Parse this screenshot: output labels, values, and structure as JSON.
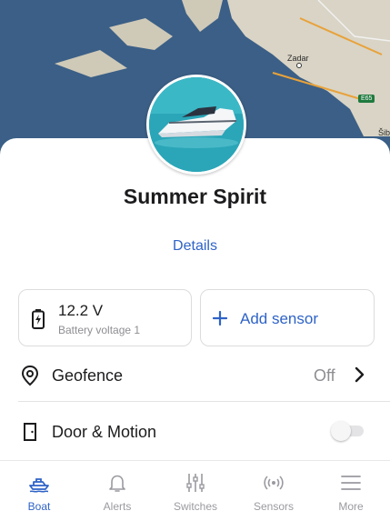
{
  "map": {
    "city_label": "Zadar",
    "road_shield": "E65",
    "edge_label": "Šib"
  },
  "boat": {
    "name": "Summer Spirit",
    "details_label": "Details"
  },
  "cards": {
    "battery": {
      "value": "12.2 V",
      "label": "Battery voltage 1",
      "icon": "battery-charging-icon"
    },
    "add_sensor": {
      "label": "Add sensor",
      "icon": "plus-icon"
    }
  },
  "rows": {
    "geofence": {
      "label": "Geofence",
      "value": "Off",
      "icon": "location-pin-icon"
    },
    "door_motion": {
      "label": "Door & Motion",
      "icon": "door-icon",
      "toggle_on": false
    }
  },
  "tabs": [
    {
      "label": "Boat",
      "icon": "boat-icon",
      "active": true
    },
    {
      "label": "Alerts",
      "icon": "bell-icon",
      "active": false
    },
    {
      "label": "Switches",
      "icon": "sliders-icon",
      "active": false
    },
    {
      "label": "Sensors",
      "icon": "broadcast-icon",
      "active": false
    },
    {
      "label": "More",
      "icon": "menu-icon",
      "active": false
    }
  ],
  "colors": {
    "accent": "#2f63c7",
    "inactive": "#9a9aa0",
    "map_water": "#3b5f86"
  }
}
